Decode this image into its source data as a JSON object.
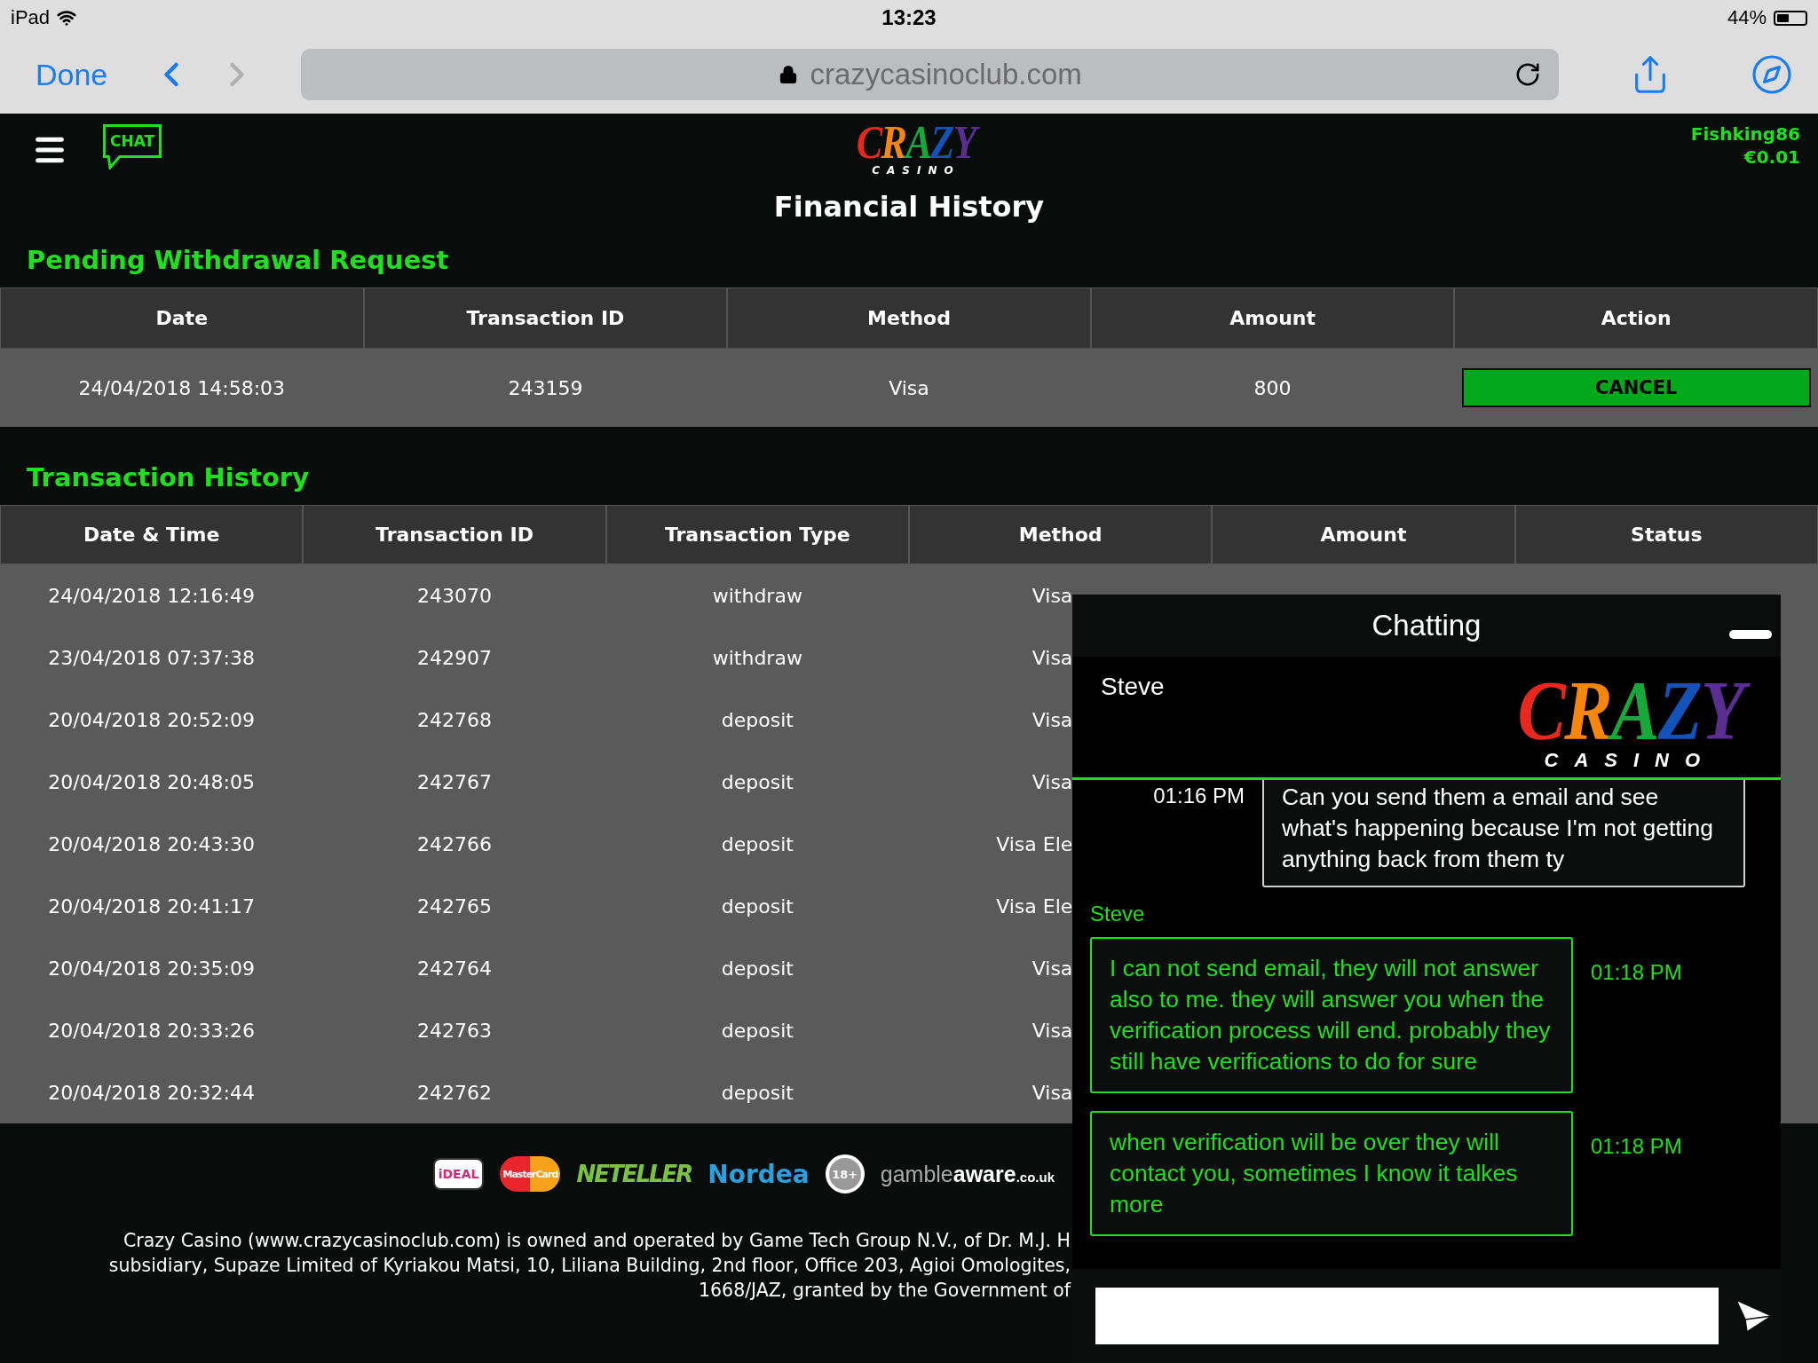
{
  "status_bar": {
    "device": "iPad",
    "time": "13:23",
    "battery": "44%"
  },
  "browser": {
    "done": "Done",
    "url": "crazycasinoclub.com",
    "back_disabled": false,
    "forward_disabled": true
  },
  "header": {
    "chat_label": "CHAT",
    "logo": {
      "word": "CRAZY",
      "sub": "CASINO"
    },
    "username": "Fishking86",
    "balance": "€0.01"
  },
  "title": "Financial History",
  "pending": {
    "heading": "Pending Withdrawal Request",
    "columns": [
      "Date",
      "Transaction ID",
      "Method",
      "Amount",
      "Action"
    ],
    "rows": [
      {
        "date": "24/04/2018 14:58:03",
        "id": "243159",
        "method": "Visa",
        "amount": "800",
        "action": "CANCEL"
      }
    ]
  },
  "history": {
    "heading": "Transaction History",
    "columns": [
      "Date & Time",
      "Transaction ID",
      "Transaction Type",
      "Method",
      "Amount",
      "Status"
    ],
    "rows": [
      {
        "datetime": "24/04/2018 12:16:49",
        "id": "243070",
        "type": "withdraw",
        "method": "Visa"
      },
      {
        "datetime": "23/04/2018 07:37:38",
        "id": "242907",
        "type": "withdraw",
        "method": "Visa"
      },
      {
        "datetime": "20/04/2018 20:52:09",
        "id": "242768",
        "type": "deposit",
        "method": "Visa"
      },
      {
        "datetime": "20/04/2018 20:48:05",
        "id": "242767",
        "type": "deposit",
        "method": "Visa"
      },
      {
        "datetime": "20/04/2018 20:43:30",
        "id": "242766",
        "type": "deposit",
        "method": "Visa Ele"
      },
      {
        "datetime": "20/04/2018 20:41:17",
        "id": "242765",
        "type": "deposit",
        "method": "Visa Ele"
      },
      {
        "datetime": "20/04/2018 20:35:09",
        "id": "242764",
        "type": "deposit",
        "method": "Visa"
      },
      {
        "datetime": "20/04/2018 20:33:26",
        "id": "242763",
        "type": "deposit",
        "method": "Visa"
      },
      {
        "datetime": "20/04/2018 20:32:44",
        "id": "242762",
        "type": "deposit",
        "method": "Visa"
      }
    ]
  },
  "footer": {
    "logos": [
      {
        "kind": "ideal",
        "text": "iDEAL"
      },
      {
        "kind": "mastercard",
        "text": "MasterCard"
      },
      {
        "kind": "neteller",
        "text": "NETELLER"
      },
      {
        "kind": "nordea",
        "text": "Nordea"
      },
      {
        "kind": "age",
        "text": "18+"
      },
      {
        "kind": "gambleaware",
        "parts": [
          "gamble",
          "aware",
          ".co.uk"
        ]
      }
    ],
    "lines": [
      "Crazy Casino (www.crazycasinoclub.com) is owned and operated by Game Tech Group N.V., of Dr. M.J. H",
      "subsidiary, Supaze Limited of Kyriakou Matsi, 10, Liliana Building, 2nd floor, Office 203, Agioi Omologites,",
      "1668/JAZ, granted by the Government of"
    ]
  },
  "chat": {
    "title": "Chatting",
    "agent": "Steve",
    "logo": {
      "word": "CRAZY",
      "sub": "CASINO"
    },
    "messages": [
      {
        "kind": "user",
        "time": "01:16 PM",
        "text": "Can you send them a email and see what's happening because I'm not getting anything back from them ty"
      },
      {
        "kind": "sender",
        "name": "Steve"
      },
      {
        "kind": "agent",
        "time": "01:18 PM",
        "text": "I can not send email, they will not answer also to me. they will answer you when the verification process will end. probably they still have verifications to do for sure"
      },
      {
        "kind": "agent",
        "time": "01:18 PM",
        "text": "when verification will be over they will contact you, sometimes I know it talkes more"
      }
    ]
  }
}
